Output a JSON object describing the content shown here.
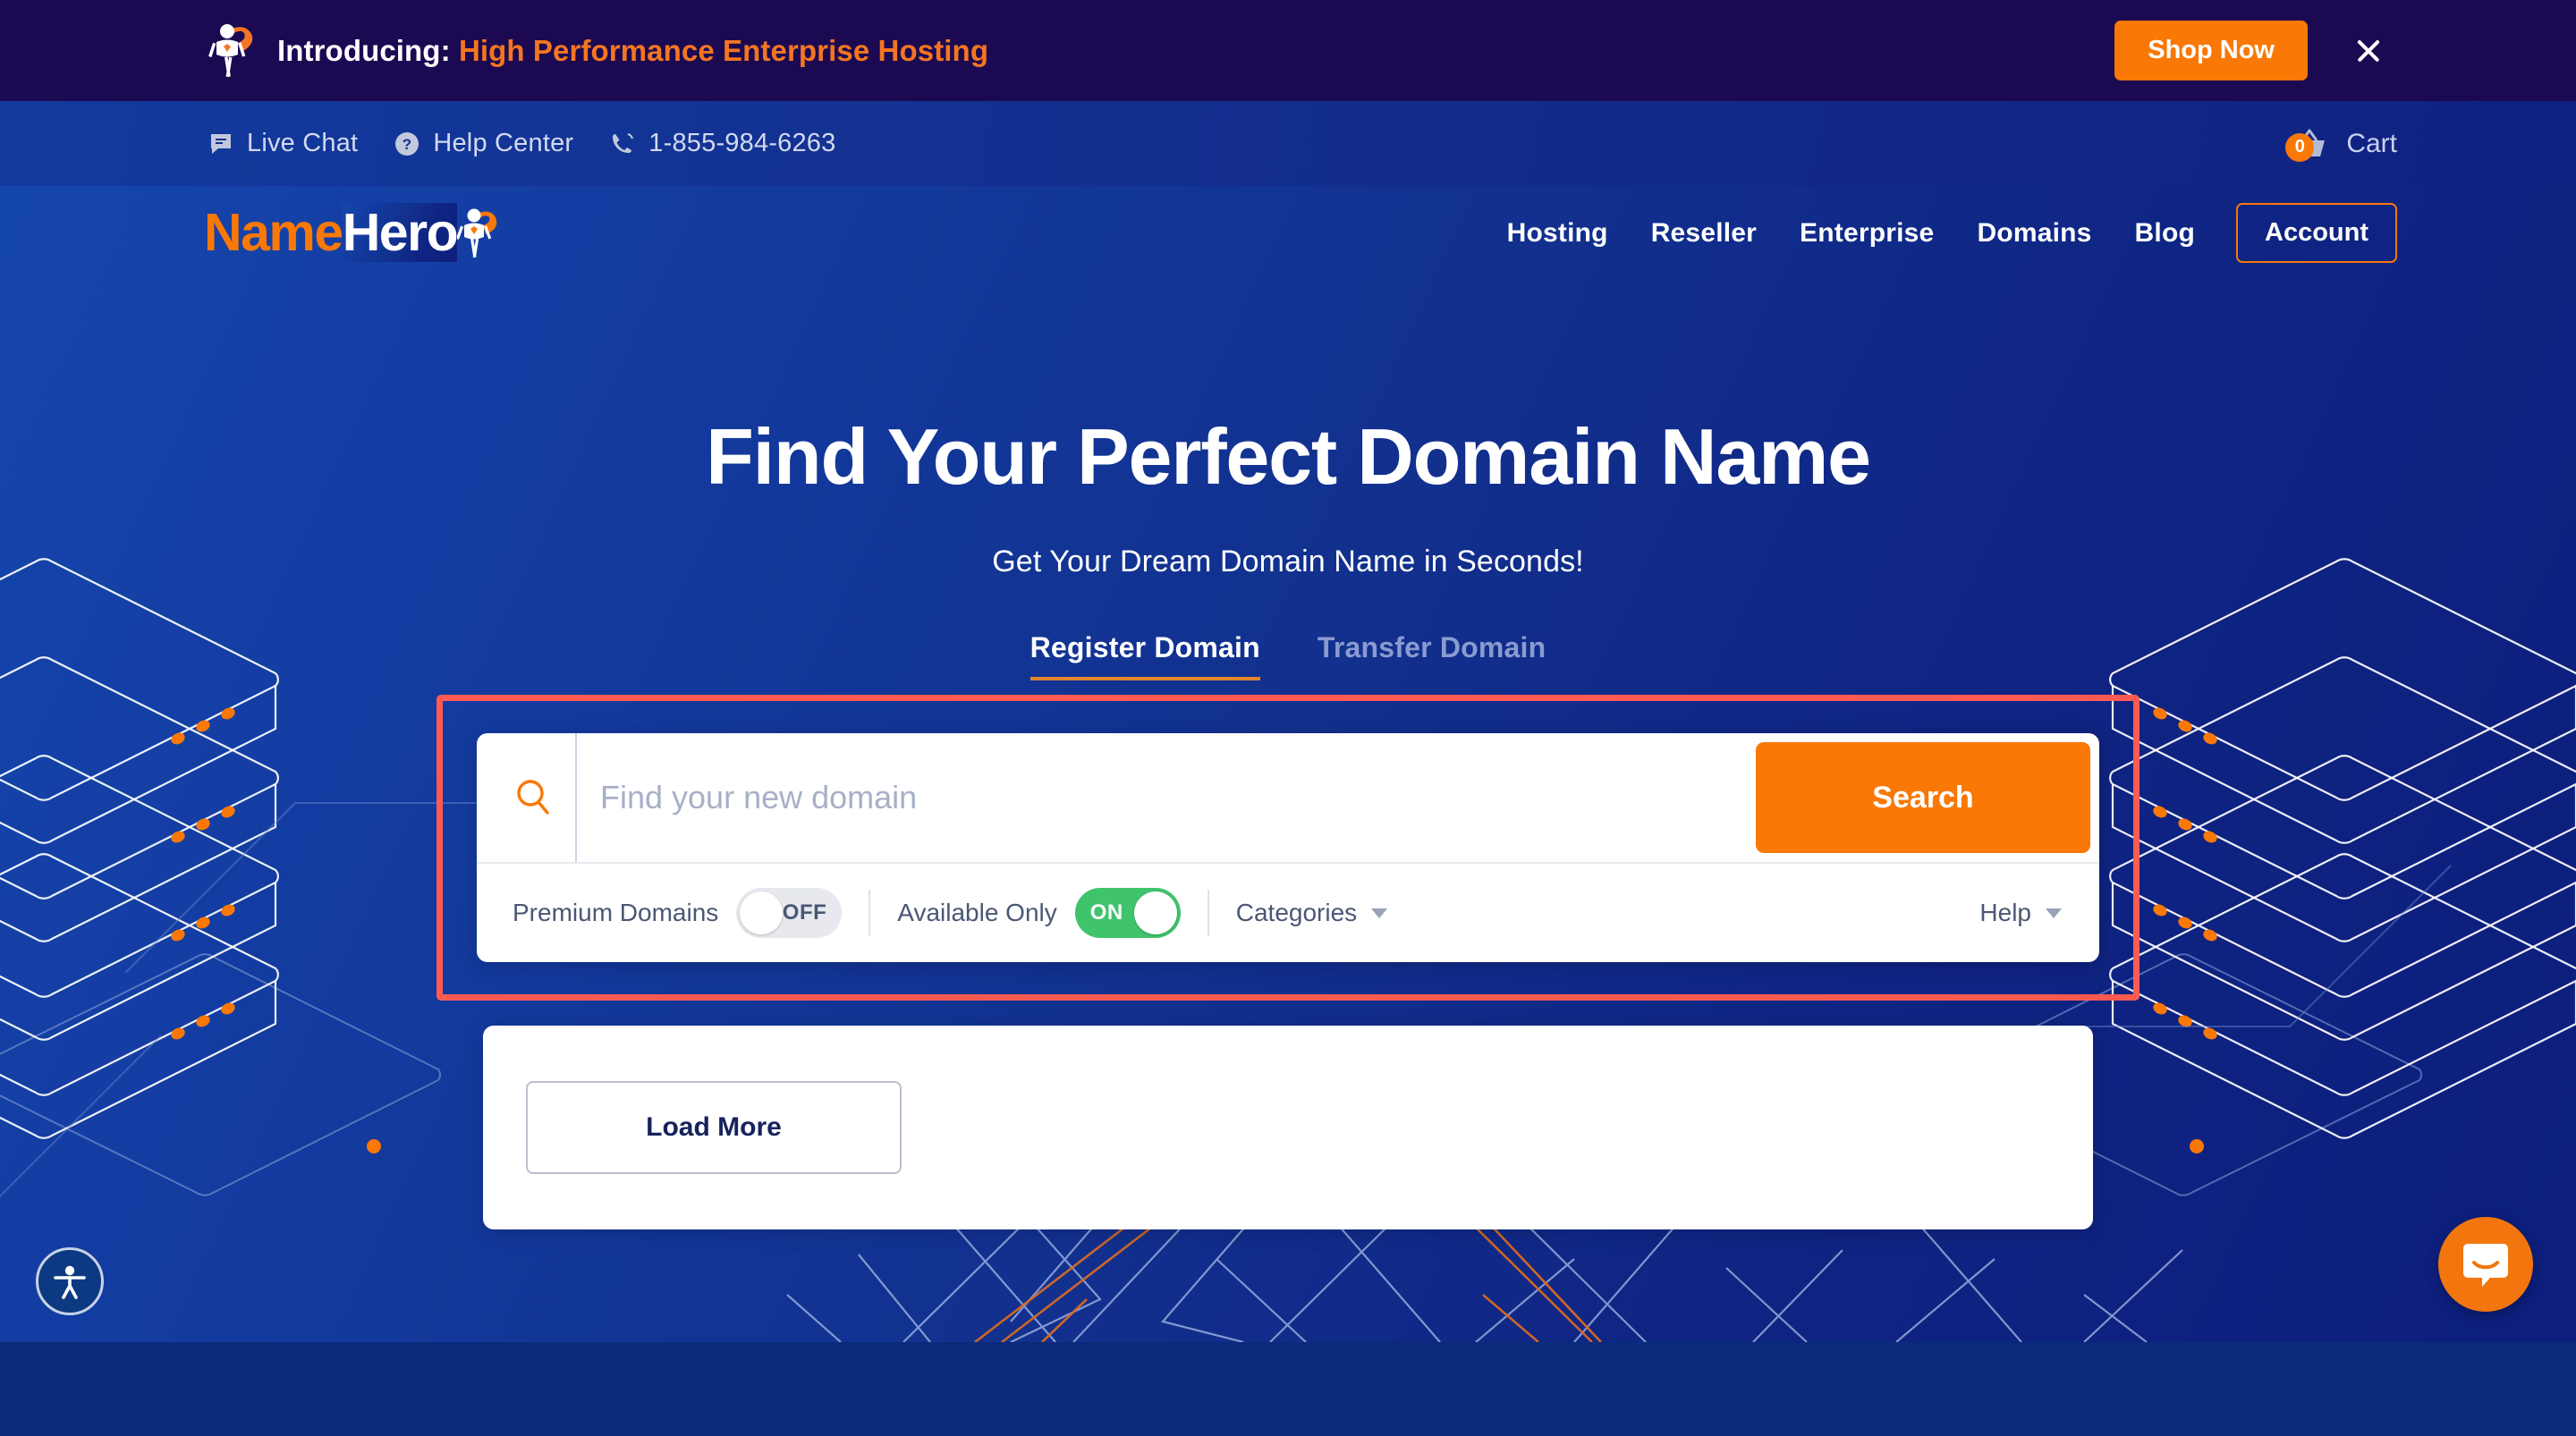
{
  "promo": {
    "intro_label": "Introducing:",
    "highlight_label": "High Performance Enterprise Hosting",
    "cta_label": "Shop Now",
    "close_label": "×",
    "bg_color": "#1b0a52",
    "accent_color": "#f47521"
  },
  "utility": {
    "items": [
      {
        "icon": "chat-bubble-icon",
        "label": "Live Chat"
      },
      {
        "icon": "question-circle-icon",
        "label": "Help Center"
      },
      {
        "icon": "phone-icon",
        "label": "1-855-984-6263"
      }
    ],
    "cart": {
      "icon": "cart-icon",
      "count": "0",
      "label": "Cart",
      "badge_color": "#f97806"
    }
  },
  "header": {
    "logo": {
      "part1": "Name",
      "part2": "Hero",
      "mark": "superhero-icon"
    },
    "nav": [
      {
        "label": "Hosting"
      },
      {
        "label": "Reseller"
      },
      {
        "label": "Enterprise"
      },
      {
        "label": "Domains"
      },
      {
        "label": "Blog"
      }
    ],
    "account_label": "Account",
    "account_border_color": "#f97806"
  },
  "hero": {
    "title": "Find Your Perfect Domain Name",
    "subtitle": "Get Your Dream Domain Name in Seconds!",
    "tabs": [
      {
        "label": "Register Domain",
        "active": true
      },
      {
        "label": "Transfer Domain",
        "active": false
      }
    ],
    "tab_underline_color": "#e2862c"
  },
  "search": {
    "highlight_border_color": "#ff5a52",
    "icon": "magnifier-icon",
    "value": "",
    "placeholder": "Find your new domain",
    "button_label": "Search",
    "button_color": "#f97806",
    "options": {
      "premium": {
        "label": "Premium Domains",
        "state": "OFF",
        "on": false
      },
      "available": {
        "label": "Available Only",
        "state": "ON",
        "on": true,
        "on_color": "#3fc46c"
      },
      "categories": {
        "label": "Categories",
        "icon": "chevron-down-icon"
      },
      "help": {
        "label": "Help",
        "icon": "chevron-down-icon"
      }
    }
  },
  "results": {
    "load_more_label": "Load More"
  },
  "widgets": {
    "accessibility": {
      "icon": "accessibility-icon",
      "label": "Accessibility"
    },
    "chat": {
      "icon": "intercom-chat-icon",
      "label": "Open chat",
      "color": "#f2760d"
    }
  }
}
